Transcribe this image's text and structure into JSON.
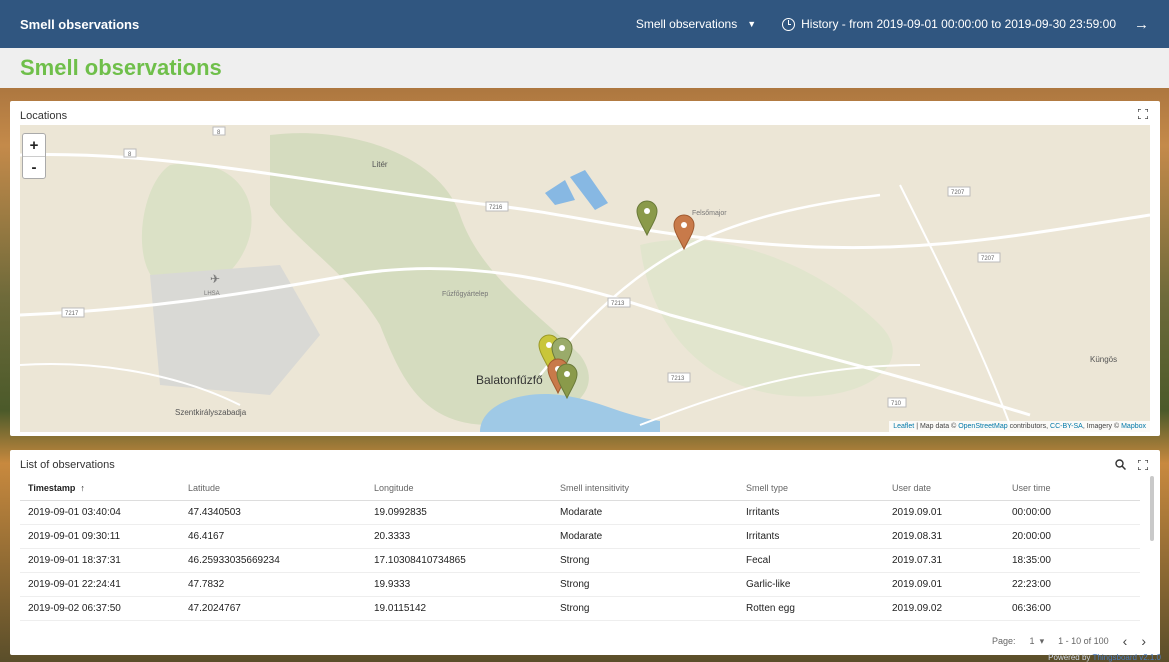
{
  "header": {
    "app_title": "Smell observations",
    "dashboard_select": "Smell observations",
    "history": "History - from 2019-09-01 00:00:00 to 2019-09-30 23:59:00"
  },
  "page_title": "Smell observations",
  "map_widget": {
    "title": "Locations",
    "zoom_in": "+",
    "zoom_out": "-",
    "labels": {
      "liter": "Litér",
      "felsomajor": "Felsőmajor",
      "fuzfogyartelep": "Fűzfőgyártelep",
      "balatonfuzfo": "Balatonfűzfő",
      "szentkiralyszabadja": "Szentkirályszabadja",
      "kungos": "Küngös",
      "lhsa": "LHSA"
    },
    "roads": [
      "8",
      "8",
      "7216",
      "7213",
      "7213",
      "7217",
      "7207",
      "7207",
      "710"
    ],
    "attribution": {
      "leaflet": "Leaflet",
      "sep1": " | Map data © ",
      "osm": "OpenStreetMap",
      "sep2": " contributors, ",
      "license": "CC-BY-SA",
      "sep3": ", Imagery © ",
      "mapbox": "Mapbox"
    },
    "marker_colors": {
      "olive": "#8a9a4a",
      "orange": "#c87a4a",
      "yellow": "#c9c63a",
      "green": "#9aab6a"
    }
  },
  "list_widget": {
    "title": "List of observations",
    "columns": [
      "Timestamp",
      "Latitude",
      "Longitude",
      "Smell intensitivity",
      "Smell type",
      "User date",
      "User time"
    ],
    "rows": [
      [
        "2019-09-01 03:40:04",
        "47.4340503",
        "19.0992835",
        "Modarate",
        "Irritants",
        "2019.09.01",
        "00:00:00"
      ],
      [
        "2019-09-01 09:30:11",
        "46.4167",
        "20.3333",
        "Modarate",
        "Irritants",
        "2019.08.31",
        "20:00:00"
      ],
      [
        "2019-09-01 18:37:31",
        "46.25933035669234",
        "17.10308410734865",
        "Strong",
        "Fecal",
        "2019.07.31",
        "18:35:00"
      ],
      [
        "2019-09-01 22:24:41",
        "47.7832",
        "19.9333",
        "Strong",
        "Garlic-like",
        "2019.09.01",
        "22:23:00"
      ],
      [
        "2019-09-02 06:37:50",
        "47.2024767",
        "19.0115142",
        "Strong",
        "Rotten egg",
        "2019.09.02",
        "06:36:00"
      ]
    ],
    "pager": {
      "page_label": "Page:",
      "page_value": "1",
      "range": "1 - 10 of 100"
    }
  },
  "footer": {
    "powered_prefix": "Powered by ",
    "brand": "Thingsboard v2.1.0"
  }
}
